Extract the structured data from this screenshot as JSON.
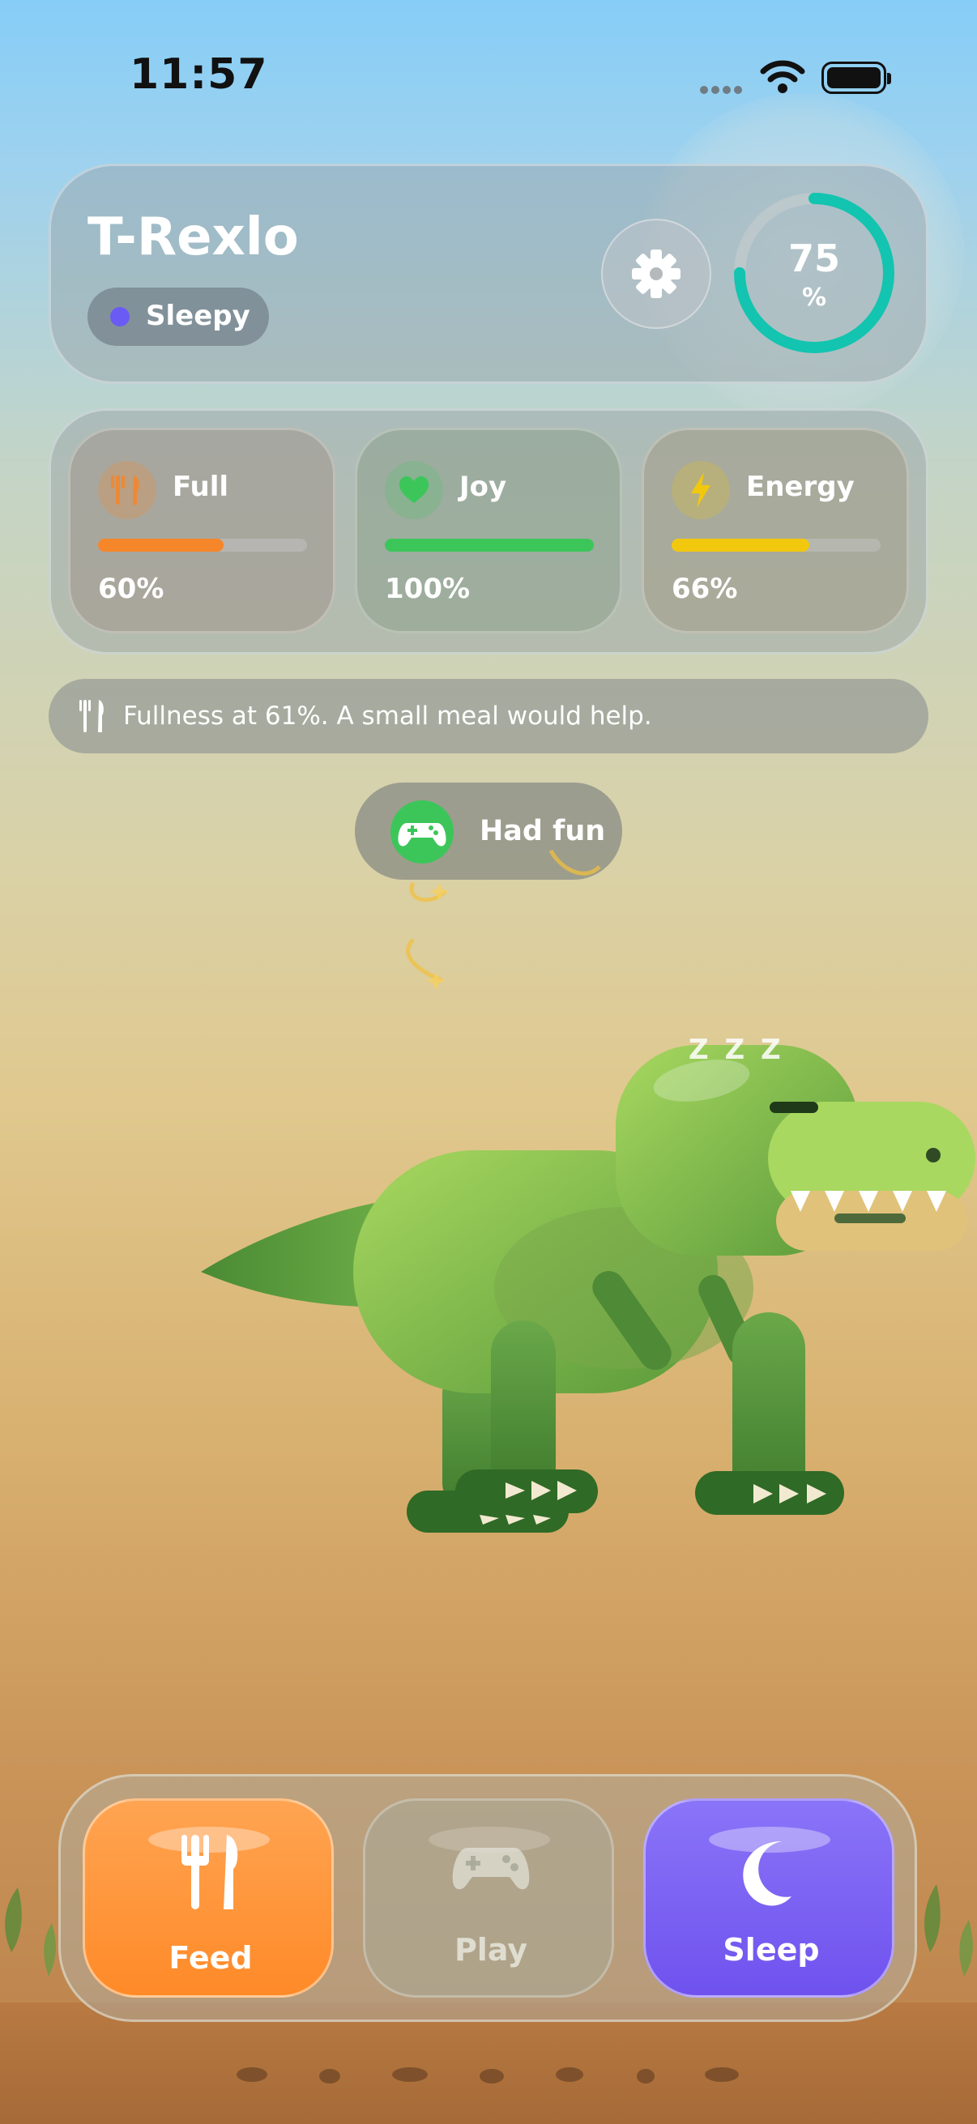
{
  "status_bar": {
    "time": "11:57"
  },
  "pet": {
    "name": "T-Rexlo",
    "mood": "Sleepy",
    "mood_color": "#6b5bf5",
    "overall": {
      "value": "75",
      "unit": "%",
      "fraction": 0.75,
      "color": "#13c4b0"
    }
  },
  "stats": [
    {
      "label": "Full",
      "percent_text": "60%",
      "fraction": 0.6,
      "icon": "fork-knife-icon",
      "color": "#f5862a"
    },
    {
      "label": "Joy",
      "percent_text": "100%",
      "fraction": 1.0,
      "icon": "heart-icon",
      "color": "#3cc65a"
    },
    {
      "label": "Energy",
      "percent_text": "66%",
      "fraction": 0.66,
      "icon": "bolt-icon",
      "color": "#f2c80f"
    }
  ],
  "hint": {
    "icon": "fork-knife-icon",
    "text": "Fullness at 61%. A small meal would help."
  },
  "toast": {
    "icon": "gamepad-icon",
    "text": "Had fun"
  },
  "sleep_indicator": "Z Z Z",
  "actions": [
    {
      "label": "Feed",
      "icon": "fork-knife-icon",
      "color": "#ff9436",
      "enabled": true
    },
    {
      "label": "Play",
      "icon": "gamepad-icon",
      "color": "#a8aa98",
      "enabled": false
    },
    {
      "label": "Sleep",
      "icon": "moon-icon",
      "color": "#7a5ff2",
      "enabled": true
    }
  ]
}
